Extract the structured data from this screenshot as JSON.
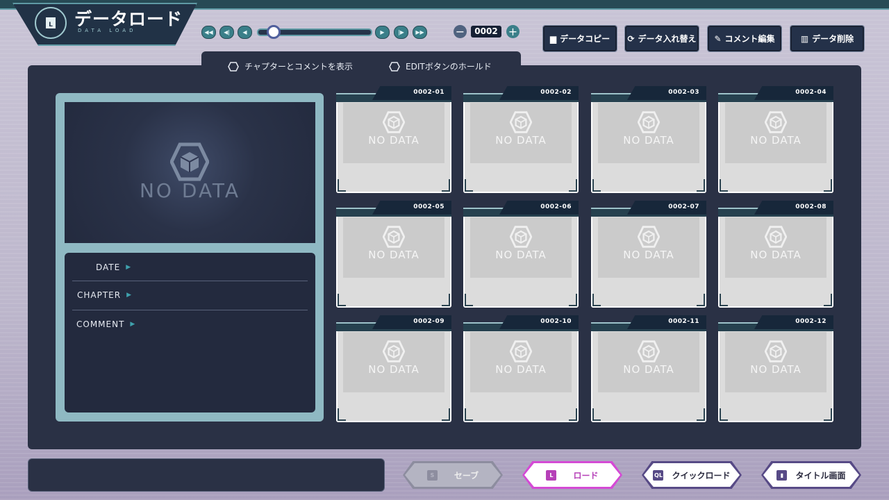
{
  "header": {
    "title": "データロード",
    "subtitle": "DATA LOAD",
    "title_icon_letter": "L"
  },
  "pager": {
    "current_page": "0002",
    "slider_fraction": 0.1
  },
  "actions": [
    {
      "label": "データコピー",
      "icon": "folder-icon"
    },
    {
      "label": "データ入れ替え",
      "icon": "swap-icon"
    },
    {
      "label": "コメント編集",
      "icon": "pencil-icon"
    },
    {
      "label": "データ削除",
      "icon": "trash-icon"
    }
  ],
  "toggles": [
    {
      "label": "チャプターとコメントを表示"
    },
    {
      "label": "EDITボタンのホールド"
    }
  ],
  "preview": {
    "nodata": "NO DATA",
    "date_label": "DATE",
    "chapter_label": "CHAPTER",
    "comment_label": "COMMENT"
  },
  "slots": [
    {
      "id": "0002-01",
      "text": "NO DATA"
    },
    {
      "id": "0002-02",
      "text": "NO DATA"
    },
    {
      "id": "0002-03",
      "text": "NO DATA"
    },
    {
      "id": "0002-04",
      "text": "NO DATA"
    },
    {
      "id": "0002-05",
      "text": "NO DATA"
    },
    {
      "id": "0002-06",
      "text": "NO DATA"
    },
    {
      "id": "0002-07",
      "text": "NO DATA"
    },
    {
      "id": "0002-08",
      "text": "NO DATA"
    },
    {
      "id": "0002-09",
      "text": "NO DATA"
    },
    {
      "id": "0002-10",
      "text": "NO DATA"
    },
    {
      "id": "0002-11",
      "text": "NO DATA"
    },
    {
      "id": "0002-12",
      "text": "NO DATA"
    }
  ],
  "nav": [
    {
      "label": "セーブ",
      "state": "disabled",
      "icon_letter": "S"
    },
    {
      "label": "ロード",
      "state": "active",
      "icon_letter": "L"
    },
    {
      "label": "クイックロード",
      "state": "normal",
      "icon_letter": "QL"
    },
    {
      "label": "タイトル画面",
      "state": "normal",
      "icon_letter": ""
    }
  ],
  "colors": {
    "accent_teal": "#3fa1ad",
    "active_magenta": "#b640b8",
    "nav_purple": "#574a86",
    "panel_dark": "#2a3145"
  }
}
